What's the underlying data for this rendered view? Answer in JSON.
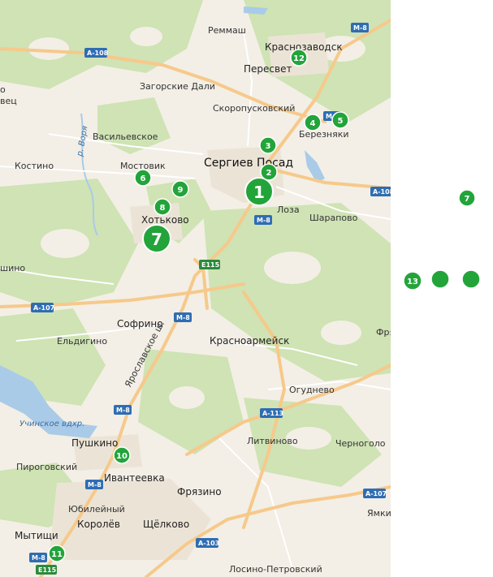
{
  "map": {
    "places": {
      "remmash": "Реммаш",
      "krasnozavodsk": "Краснозаводск",
      "a108": "А-108",
      "peresvet": "Пересвет",
      "zagorskie_dali": "Загорские Дали",
      "skoropuskovsky": "Скоропусковский",
      "bereznyaki": "Березняки",
      "vasilevskoe": "Васильевское",
      "river_vorya": "р. Воря",
      "sergiev_posad": "Сергиев Посад",
      "kostino": "Костино",
      "mostovik": "Мостовик",
      "loza": "Лоза",
      "sharapovo": "Шарапово",
      "khotkovo": "Хотьково",
      "shino": "шино",
      "sofrino": "Софрино",
      "eldigino": "Ельдигино",
      "krasnoarmeysk": "Красноармейск",
      "yaroslavskoe_sh": "Ярославское ш.",
      "ogudnevo": "Огуднево",
      "uchinskoe": "Учинское вдхр.",
      "pushkino": "Пушкино",
      "litvinovo": "Литвиново",
      "chernogolovka": "Черноголо",
      "pirogovsky": "Пироговский",
      "ivanteevka": "Ивантеевка",
      "fryazino": "Фрязино",
      "yubileyny": "Юбилейный",
      "korolev": "Королёв",
      "shchelkovo": "Щёлково",
      "mytishchi": "Мытищи",
      "yamki": "Ямки",
      "losino": "Лосино-Петровский",
      "frya_right": "Фря",
      "edge_o": "о",
      "edge_vets": "вец"
    },
    "road_shields": {
      "m8_top": "М-8",
      "a108_top": "А-108",
      "m8_bereznyaki": "М-8",
      "a108_right": "А-108",
      "m8_posad": "М-8",
      "e115_mid": "E115",
      "a107_left": "А-107",
      "m8_sofrino": "М-8",
      "m8_pushkino": "М-8",
      "a113": "А-113",
      "m8_ivanteevka": "М-8",
      "a107_right": "А-107",
      "a103": "А-103",
      "m8_bottom": "М-8",
      "e115_bottom": "E115"
    },
    "markers": [
      {
        "label": "1"
      },
      {
        "label": "2"
      },
      {
        "label": "3"
      },
      {
        "label": "4"
      },
      {
        "label": "5"
      },
      {
        "label": "6"
      },
      {
        "label": "7"
      },
      {
        "label": "8"
      },
      {
        "label": "9"
      },
      {
        "label": "10"
      },
      {
        "label": "11"
      },
      {
        "label": "12"
      }
    ],
    "colors": {
      "land": "#f3efe6",
      "forest": "#cfe3b4",
      "water": "#a9cbe8",
      "road_major": "#f6c98b",
      "road_minor": "#ffffff",
      "marker": "#22a43a",
      "shield_blue": "#2f6db3"
    }
  },
  "side_panel": {
    "markers": [
      {
        "label": "7"
      },
      {
        "label": "13"
      },
      {
        "label": ""
      },
      {
        "label": ""
      }
    ]
  }
}
